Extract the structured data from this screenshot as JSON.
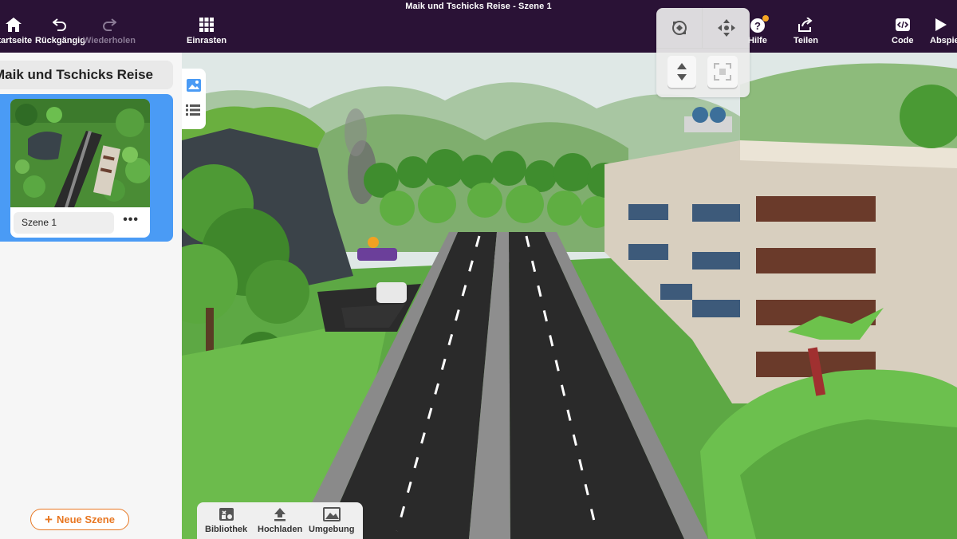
{
  "window": {
    "title": "Maik und Tschicks Reise - Szene 1"
  },
  "toolbar": {
    "home_label": "Startseite",
    "undo_label": "Rückgängig",
    "redo_label": "Wiederholen",
    "snap_label": "Einrasten",
    "help_label": "Hilfe",
    "share_label": "Teilen",
    "code_label": "Code",
    "play_label": "Abspielen"
  },
  "sidebar": {
    "project_title": "Maik und Tschicks Reise",
    "scenes": [
      {
        "name": "Szene 1",
        "more": "•••"
      }
    ],
    "new_scene_label": "Neue Szene"
  },
  "bottom_bar": {
    "library_label": "Bibliothek",
    "upload_label": "Hochladen",
    "environment_label": "Umgebung"
  },
  "colors": {
    "toolbar_bg": "#2a1236",
    "accent_blue": "#4a9bf5",
    "accent_orange": "#e87722",
    "help_badge": "#f5a623"
  },
  "icons": {
    "home": "home-icon",
    "undo": "undo-icon",
    "redo": "redo-icon",
    "snap": "grid-icon",
    "help": "help-icon",
    "share": "share-icon",
    "code": "code-icon",
    "play": "play-icon",
    "orbit": "orbit-icon",
    "pan": "move-icon",
    "updown": "up-down-icon",
    "fit": "fit-view-icon",
    "scenes_tab": "image-icon",
    "list_tab": "list-icon",
    "library": "library-icon",
    "upload": "upload-icon",
    "environment": "environment-icon"
  }
}
